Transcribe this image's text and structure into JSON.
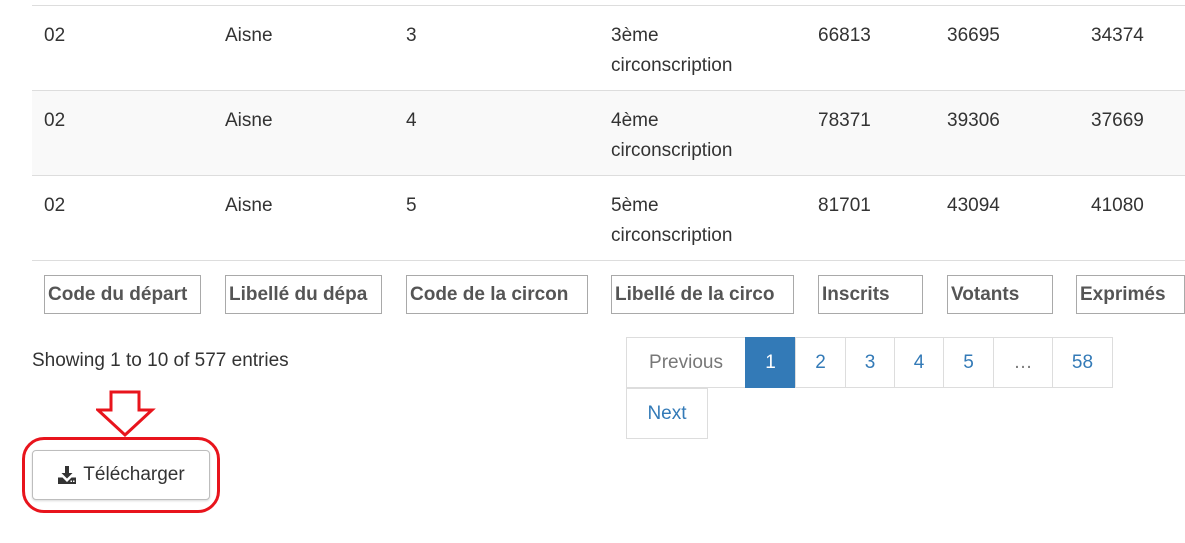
{
  "table": {
    "rows": [
      {
        "cells": [
          "02",
          "Aisne",
          "3",
          "3ème circonscription",
          "66813",
          "36695",
          "34374"
        ]
      },
      {
        "cells": [
          "02",
          "Aisne",
          "4",
          "4ème circonscription",
          "78371",
          "39306",
          "37669"
        ]
      },
      {
        "cells": [
          "02",
          "Aisne",
          "5",
          "5ème circonscription",
          "81701",
          "43094",
          "41080"
        ]
      }
    ],
    "filters": [
      "Code du départ",
      "Libellé du dépa",
      "Code de la circon",
      "Libellé de la circo",
      "Inscrits",
      "Votants",
      "Exprimés"
    ]
  },
  "info": "Showing 1 to 10 of 577 entries",
  "pagination": {
    "previous": "Previous",
    "pages": [
      "1",
      "2",
      "3",
      "4",
      "5",
      "…",
      "58"
    ],
    "active_page": "1",
    "next": "Next"
  },
  "download": {
    "label": "Télécharger",
    "icon": "download-icon"
  },
  "annotation": {
    "color": "#e8141c",
    "arrow_icon": "down-arrow-icon"
  },
  "colors": {
    "link": "#337ab7",
    "active_bg": "#337ab7",
    "stripe": "#f9f9f9",
    "border": "#dddddd"
  }
}
